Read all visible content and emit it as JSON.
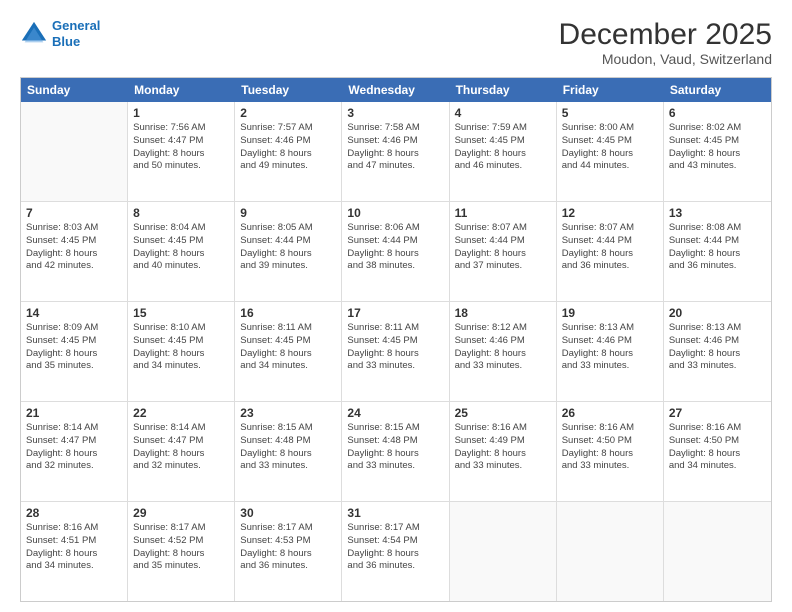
{
  "header": {
    "logo_line1": "General",
    "logo_line2": "Blue",
    "title": "December 2025",
    "subtitle": "Moudon, Vaud, Switzerland"
  },
  "calendar": {
    "days_of_week": [
      "Sunday",
      "Monday",
      "Tuesday",
      "Wednesday",
      "Thursday",
      "Friday",
      "Saturday"
    ],
    "weeks": [
      [
        {
          "day": "",
          "sunrise": "",
          "sunset": "",
          "daylight": ""
        },
        {
          "day": "1",
          "sunrise": "Sunrise: 7:56 AM",
          "sunset": "Sunset: 4:47 PM",
          "daylight": "Daylight: 8 hours and 50 minutes."
        },
        {
          "day": "2",
          "sunrise": "Sunrise: 7:57 AM",
          "sunset": "Sunset: 4:46 PM",
          "daylight": "Daylight: 8 hours and 49 minutes."
        },
        {
          "day": "3",
          "sunrise": "Sunrise: 7:58 AM",
          "sunset": "Sunset: 4:46 PM",
          "daylight": "Daylight: 8 hours and 47 minutes."
        },
        {
          "day": "4",
          "sunrise": "Sunrise: 7:59 AM",
          "sunset": "Sunset: 4:45 PM",
          "daylight": "Daylight: 8 hours and 46 minutes."
        },
        {
          "day": "5",
          "sunrise": "Sunrise: 8:00 AM",
          "sunset": "Sunset: 4:45 PM",
          "daylight": "Daylight: 8 hours and 44 minutes."
        },
        {
          "day": "6",
          "sunrise": "Sunrise: 8:02 AM",
          "sunset": "Sunset: 4:45 PM",
          "daylight": "Daylight: 8 hours and 43 minutes."
        }
      ],
      [
        {
          "day": "7",
          "sunrise": "Sunrise: 8:03 AM",
          "sunset": "Sunset: 4:45 PM",
          "daylight": "Daylight: 8 hours and 42 minutes."
        },
        {
          "day": "8",
          "sunrise": "Sunrise: 8:04 AM",
          "sunset": "Sunset: 4:45 PM",
          "daylight": "Daylight: 8 hours and 40 minutes."
        },
        {
          "day": "9",
          "sunrise": "Sunrise: 8:05 AM",
          "sunset": "Sunset: 4:44 PM",
          "daylight": "Daylight: 8 hours and 39 minutes."
        },
        {
          "day": "10",
          "sunrise": "Sunrise: 8:06 AM",
          "sunset": "Sunset: 4:44 PM",
          "daylight": "Daylight: 8 hours and 38 minutes."
        },
        {
          "day": "11",
          "sunrise": "Sunrise: 8:07 AM",
          "sunset": "Sunset: 4:44 PM",
          "daylight": "Daylight: 8 hours and 37 minutes."
        },
        {
          "day": "12",
          "sunrise": "Sunrise: 8:07 AM",
          "sunset": "Sunset: 4:44 PM",
          "daylight": "Daylight: 8 hours and 36 minutes."
        },
        {
          "day": "13",
          "sunrise": "Sunrise: 8:08 AM",
          "sunset": "Sunset: 4:44 PM",
          "daylight": "Daylight: 8 hours and 36 minutes."
        }
      ],
      [
        {
          "day": "14",
          "sunrise": "Sunrise: 8:09 AM",
          "sunset": "Sunset: 4:45 PM",
          "daylight": "Daylight: 8 hours and 35 minutes."
        },
        {
          "day": "15",
          "sunrise": "Sunrise: 8:10 AM",
          "sunset": "Sunset: 4:45 PM",
          "daylight": "Daylight: 8 hours and 34 minutes."
        },
        {
          "day": "16",
          "sunrise": "Sunrise: 8:11 AM",
          "sunset": "Sunset: 4:45 PM",
          "daylight": "Daylight: 8 hours and 34 minutes."
        },
        {
          "day": "17",
          "sunrise": "Sunrise: 8:11 AM",
          "sunset": "Sunset: 4:45 PM",
          "daylight": "Daylight: 8 hours and 33 minutes."
        },
        {
          "day": "18",
          "sunrise": "Sunrise: 8:12 AM",
          "sunset": "Sunset: 4:46 PM",
          "daylight": "Daylight: 8 hours and 33 minutes."
        },
        {
          "day": "19",
          "sunrise": "Sunrise: 8:13 AM",
          "sunset": "Sunset: 4:46 PM",
          "daylight": "Daylight: 8 hours and 33 minutes."
        },
        {
          "day": "20",
          "sunrise": "Sunrise: 8:13 AM",
          "sunset": "Sunset: 4:46 PM",
          "daylight": "Daylight: 8 hours and 33 minutes."
        }
      ],
      [
        {
          "day": "21",
          "sunrise": "Sunrise: 8:14 AM",
          "sunset": "Sunset: 4:47 PM",
          "daylight": "Daylight: 8 hours and 32 minutes."
        },
        {
          "day": "22",
          "sunrise": "Sunrise: 8:14 AM",
          "sunset": "Sunset: 4:47 PM",
          "daylight": "Daylight: 8 hours and 32 minutes."
        },
        {
          "day": "23",
          "sunrise": "Sunrise: 8:15 AM",
          "sunset": "Sunset: 4:48 PM",
          "daylight": "Daylight: 8 hours and 33 minutes."
        },
        {
          "day": "24",
          "sunrise": "Sunrise: 8:15 AM",
          "sunset": "Sunset: 4:48 PM",
          "daylight": "Daylight: 8 hours and 33 minutes."
        },
        {
          "day": "25",
          "sunrise": "Sunrise: 8:16 AM",
          "sunset": "Sunset: 4:49 PM",
          "daylight": "Daylight: 8 hours and 33 minutes."
        },
        {
          "day": "26",
          "sunrise": "Sunrise: 8:16 AM",
          "sunset": "Sunset: 4:50 PM",
          "daylight": "Daylight: 8 hours and 33 minutes."
        },
        {
          "day": "27",
          "sunrise": "Sunrise: 8:16 AM",
          "sunset": "Sunset: 4:50 PM",
          "daylight": "Daylight: 8 hours and 34 minutes."
        }
      ],
      [
        {
          "day": "28",
          "sunrise": "Sunrise: 8:16 AM",
          "sunset": "Sunset: 4:51 PM",
          "daylight": "Daylight: 8 hours and 34 minutes."
        },
        {
          "day": "29",
          "sunrise": "Sunrise: 8:17 AM",
          "sunset": "Sunset: 4:52 PM",
          "daylight": "Daylight: 8 hours and 35 minutes."
        },
        {
          "day": "30",
          "sunrise": "Sunrise: 8:17 AM",
          "sunset": "Sunset: 4:53 PM",
          "daylight": "Daylight: 8 hours and 36 minutes."
        },
        {
          "day": "31",
          "sunrise": "Sunrise: 8:17 AM",
          "sunset": "Sunset: 4:54 PM",
          "daylight": "Daylight: 8 hours and 36 minutes."
        },
        {
          "day": "",
          "sunrise": "",
          "sunset": "",
          "daylight": ""
        },
        {
          "day": "",
          "sunrise": "",
          "sunset": "",
          "daylight": ""
        },
        {
          "day": "",
          "sunrise": "",
          "sunset": "",
          "daylight": ""
        }
      ]
    ]
  }
}
